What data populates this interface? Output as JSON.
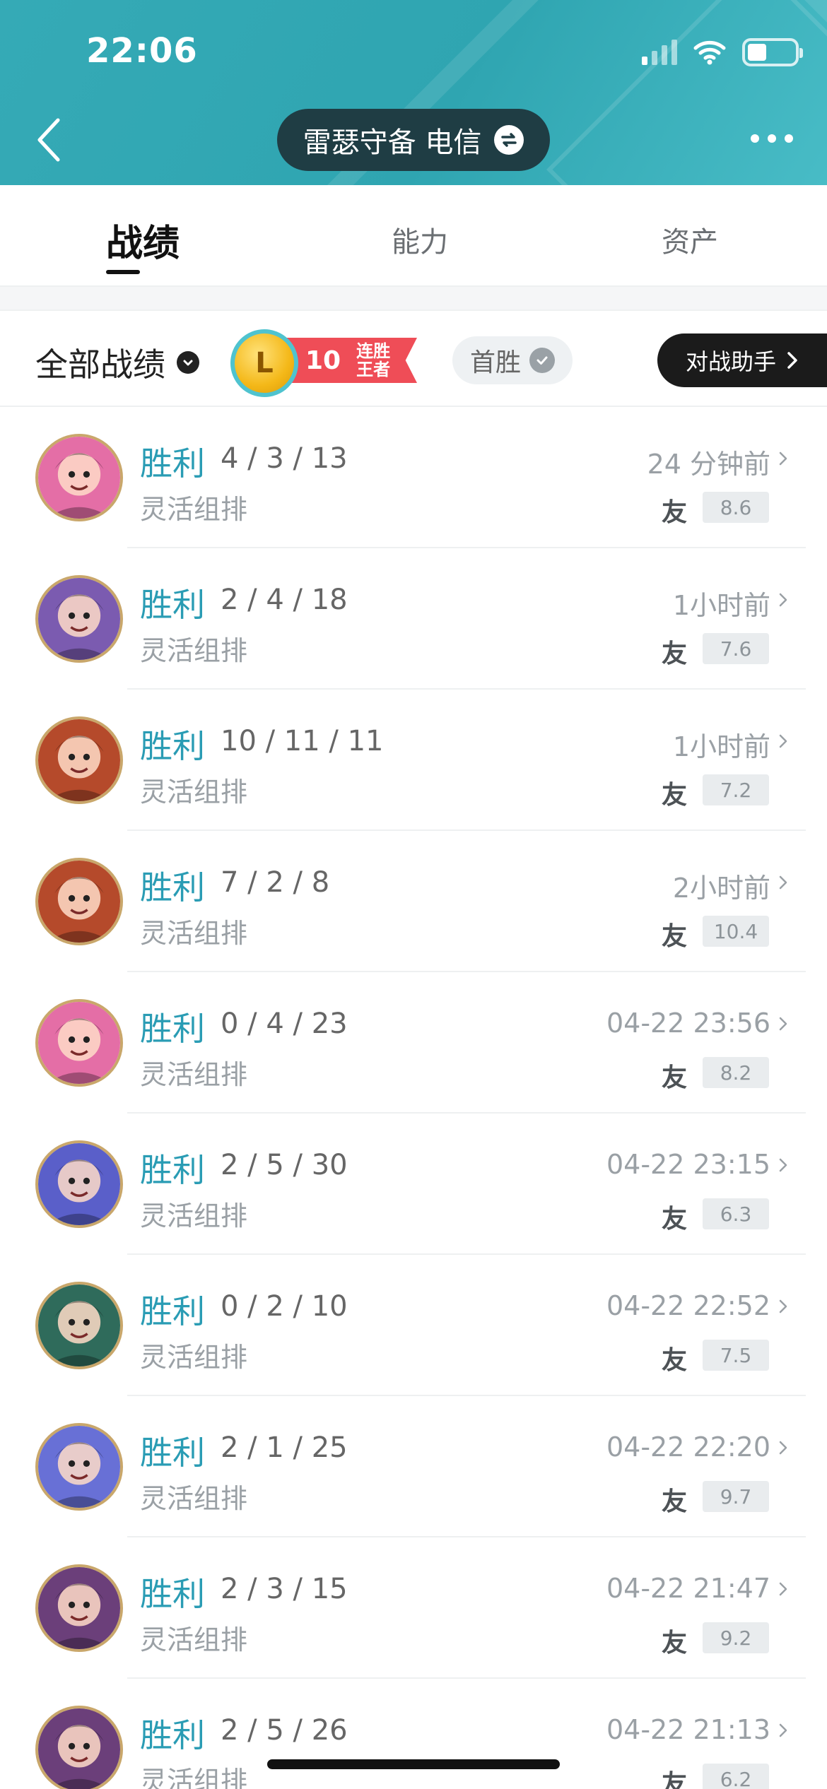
{
  "status_bar": {
    "time": "22:06"
  },
  "header": {
    "title": "雷瑟守备 电信"
  },
  "tabs": [
    {
      "label": "战绩",
      "active": true
    },
    {
      "label": "能力",
      "active": false
    },
    {
      "label": "资产",
      "active": false
    }
  ],
  "filter": {
    "all_label": "全部战绩",
    "streak_badge": {
      "count": "10",
      "text": "连胜王者",
      "trophy_letter": "L"
    },
    "first_win_label": "首胜",
    "assistant_label": "对战助手"
  },
  "matches": [
    {
      "result": "胜利",
      "kda": "4 / 3 / 13",
      "mode": "灵活组排",
      "time": "24 分钟前",
      "friend_tag": "友",
      "score": "8.6",
      "avatar_color": "#e46ea6"
    },
    {
      "result": "胜利",
      "kda": "2 / 4 / 18",
      "mode": "灵活组排",
      "time": "1小时前",
      "friend_tag": "友",
      "score": "7.6",
      "avatar_color": "#7b5bb0"
    },
    {
      "result": "胜利",
      "kda": "10 / 11 / 11",
      "mode": "灵活组排",
      "time": "1小时前",
      "friend_tag": "友",
      "score": "7.2",
      "avatar_color": "#b54a2b"
    },
    {
      "result": "胜利",
      "kda": "7 / 2 / 8",
      "mode": "灵活组排",
      "time": "2小时前",
      "friend_tag": "友",
      "score": "10.4",
      "avatar_color": "#b54a2b"
    },
    {
      "result": "胜利",
      "kda": "0 / 4 / 23",
      "mode": "灵活组排",
      "time": "04-22 23:56",
      "friend_tag": "友",
      "score": "8.2",
      "avatar_color": "#e46ea6"
    },
    {
      "result": "胜利",
      "kda": "2 / 5 / 30",
      "mode": "灵活组排",
      "time": "04-22 23:15",
      "friend_tag": "友",
      "score": "6.3",
      "avatar_color": "#5a5fc9"
    },
    {
      "result": "胜利",
      "kda": "0 / 2 / 10",
      "mode": "灵活组排",
      "time": "04-22 22:52",
      "friend_tag": "友",
      "score": "7.5",
      "avatar_color": "#2f6b5b"
    },
    {
      "result": "胜利",
      "kda": "2 / 1 / 25",
      "mode": "灵活组排",
      "time": "04-22 22:20",
      "friend_tag": "友",
      "score": "9.7",
      "avatar_color": "#6870d6"
    },
    {
      "result": "胜利",
      "kda": "2 / 3 / 15",
      "mode": "灵活组排",
      "time": "04-22 21:47",
      "friend_tag": "友",
      "score": "9.2",
      "avatar_color": "#6b3f7a"
    },
    {
      "result": "胜利",
      "kda": "2 / 5 / 26",
      "mode": "灵活组排",
      "time": "04-22 21:13",
      "friend_tag": "友",
      "score": "6.2",
      "avatar_color": "#6b3f7a"
    }
  ],
  "colors": {
    "header_bg": "#35aab6",
    "win_text": "#2a9cb4",
    "streak_red": "#ef4d57"
  }
}
